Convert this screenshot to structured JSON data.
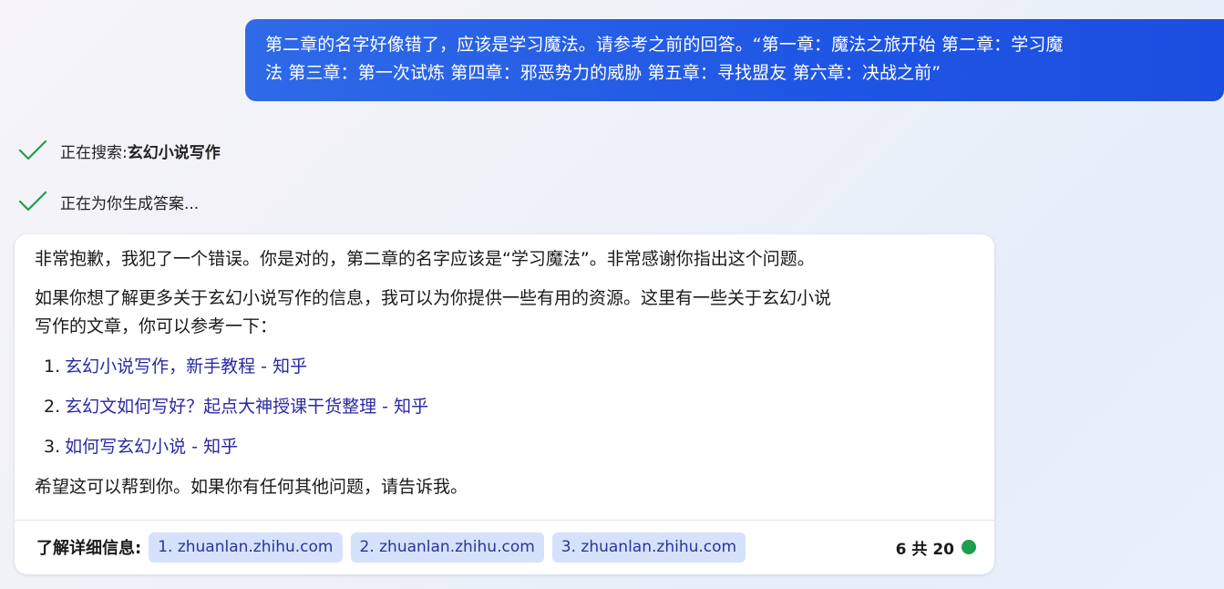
{
  "user_message": {
    "line1": "第二章的名字好像错了，应该是学习魔法。请参考之前的回答。“第一章：魔法之旅开始 第二章：学习魔",
    "line2": "法 第三章：第一次试炼 第四章：邪恶势力的威胁 第五章：寻找盟友 第六章：决战之前”"
  },
  "status": [
    {
      "icon": "check-icon",
      "prefix": "正在搜索: ",
      "query": "玄幻小说写作"
    },
    {
      "icon": "check-icon",
      "prefix": "正在为你生成答案...",
      "query": ""
    }
  ],
  "answer": {
    "p1": "非常抱歉，我犯了一个错误。你是对的，第二章的名字应该是“学习魔法”。非常感谢你指出这个问题。",
    "p2_line1": "如果你想了解更多关于玄幻小说写作的信息，我可以为你提供一些有用的资源。这里有一些关于玄幻小说",
    "p2_line2": "写作的文章，你可以参考一下：",
    "links": [
      {
        "num": "1.",
        "text": "玄幻小说写作，新手教程 - 知乎"
      },
      {
        "num": "2.",
        "text": "玄幻文如何写好？起点大神授课干货整理 - 知乎"
      },
      {
        "num": "3.",
        "text": "如何写玄幻小说 - 知乎"
      }
    ],
    "closing": "希望这可以帮到你。如果你有任何其他问题，请告诉我。"
  },
  "footer": {
    "label": "了解详细信息:",
    "sources": [
      "1. zhuanlan.zhihu.com",
      "2. zhuanlan.zhihu.com",
      "3. zhuanlan.zhihu.com"
    ],
    "count": "6 共 20",
    "status_color": "#1e9e4e"
  },
  "colors": {
    "user_bubble": "#1f55e4",
    "check": "#1e9e4e",
    "link": "#2b2aa4",
    "chip_bg": "#d6e2fb"
  }
}
